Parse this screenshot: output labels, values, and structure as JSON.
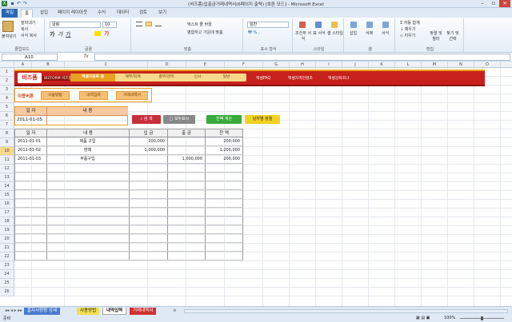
{
  "window": {
    "title": "(비즈폼)입출금거래내역서(6페이지 출력) [호환 모드] - Microsoft Excel"
  },
  "ribbon": {
    "tabs": [
      "파일",
      "홈",
      "삽입",
      "페이지 레이아웃",
      "수식",
      "데이터",
      "검토",
      "보기"
    ],
    "clipboard": {
      "paste": "붙여넣기",
      "cut": "잘라내기",
      "copy": "복사",
      "format": "서식 복사",
      "label": "클립보드"
    },
    "font": {
      "name": "굴림",
      "size": "10",
      "label": "글꼴"
    },
    "align": {
      "wrap": "텍스트 줄 바꿈",
      "merge": "병합하고 가운데 맞춤",
      "label": "맞춤"
    },
    "number": {
      "format": "일반",
      "label": "표시 형식"
    },
    "styles": {
      "cond": "조건부 서식",
      "table": "표 서식",
      "cell": "셀 스타일",
      "label": "스타일"
    },
    "cells": {
      "insert": "삽입",
      "delete": "삭제",
      "format": "서식",
      "label": "셀"
    },
    "editing": {
      "sum": "자동 합계",
      "fill": "채우기",
      "clear": "지우기",
      "sort": "정렬 및 필터",
      "find": "찾기 및 선택",
      "label": "편집"
    }
  },
  "formula_bar": {
    "name_box": "A10",
    "fx": "fx",
    "value": ""
  },
  "columns": [
    "A",
    "B",
    "C",
    "D",
    "E",
    "F",
    "G",
    "H",
    "I",
    "J",
    "K",
    "L",
    "M",
    "N",
    "O",
    "P"
  ],
  "rows": [
    "1",
    "2",
    "3",
    "4",
    "5",
    "6",
    "7",
    "8",
    "9",
    "10",
    "11",
    "12",
    "13",
    "14",
    "15",
    "16",
    "17",
    "18",
    "19",
    "20",
    "21",
    "22",
    "23",
    "24",
    "25",
    "26"
  ],
  "banner": {
    "logo": "비즈폼",
    "logo_sub": "BIZFORM 비즈폼",
    "nav": [
      "엑셀자동화 홈",
      "재무/회계",
      "총무/관리",
      "인사",
      "일반"
    ],
    "links": [
      "엑셀FAQ",
      "엑셀자격컨텐츠",
      "엑셀강좌코너"
    ]
  },
  "toolbar": {
    "label": "이용버튼",
    "buttons": [
      "사용방법",
      "내역입력",
      "거래내역서"
    ]
  },
  "input_box": {
    "h_date": "일 자",
    "h_desc": "내 용",
    "date": "2011-01-05",
    "desc": ""
  },
  "actions": {
    "search": "검 색",
    "show_all": "모두표시",
    "calc": "잔액 계산",
    "sort_date": "날자별 정렬"
  },
  "table": {
    "headers": [
      "일 자",
      "내 용",
      "입 금",
      "출 금",
      "잔 액"
    ],
    "rows": [
      {
        "date": "2011-01-01",
        "desc": "제품 구입",
        "in": "200,000",
        "out": "",
        "bal": "200,000"
      },
      {
        "date": "2011-01-02",
        "desc": "판매",
        "in": "1,000,000",
        "out": "",
        "bal": "1,200,000"
      },
      {
        "date": "2011-01-03",
        "desc": "부품구입",
        "in": "",
        "out": "1,000,000",
        "bal": "200,000"
      }
    ]
  },
  "sheets": [
    "홈자사랑방 상세",
    "사용방법",
    "내역입력",
    "거래내역서"
  ],
  "status": {
    "ready": "준비",
    "zoom": "100%"
  },
  "colors": {
    "banner": "#c8201c",
    "accent": "#e8a020",
    "excel": "#2a66b3"
  }
}
